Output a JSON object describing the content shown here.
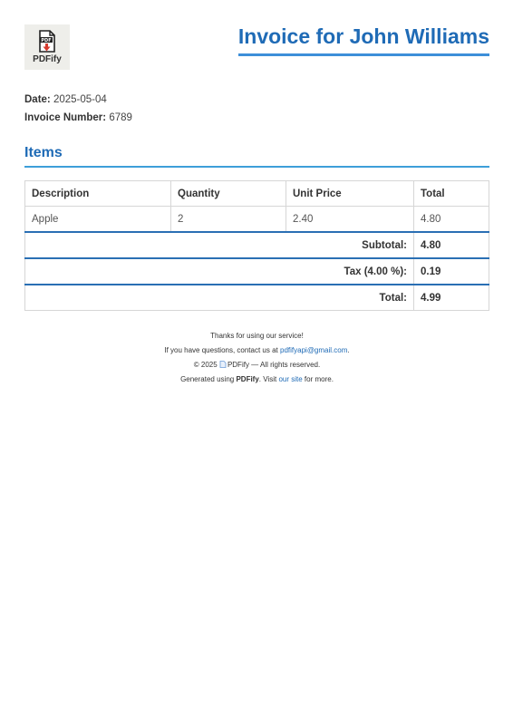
{
  "brand": {
    "logo_text": "PDFify",
    "icon": "pdf-download-icon"
  },
  "invoice": {
    "title": "Invoice for John Williams"
  },
  "meta": {
    "date_label": "Date:",
    "date_value": "2025-05-04",
    "number_label": "Invoice Number:",
    "number_value": "6789"
  },
  "items": {
    "title": "Items",
    "headers": [
      "Description",
      "Quantity",
      "Unit Price",
      "Total"
    ],
    "rows": [
      [
        "Apple",
        "2",
        "2.40",
        "4.80"
      ]
    ]
  },
  "totals": {
    "subtotal_label": "Subtotal:",
    "subtotal_value": "4.80",
    "tax_label": "Tax (4.00 %):",
    "tax_value": "0.19",
    "total_label": "Total:",
    "total_value": "4.99"
  },
  "footer": {
    "thanks": "Thanks for using our service!",
    "contact_prefix": "If you have questions, contact us at",
    "contact_email": "pdfifyapi@gmail.com",
    "contact_suffix": ".",
    "copyright_prefix": "© 2025",
    "copyright_brand": "PDFify",
    "copyright_suffix": "— All rights reserved.",
    "generated_prefix": "Generated using",
    "generated_brand": "PDFify",
    "generated_mid": ". Visit",
    "site_link": "our site",
    "generated_suffix": "for more."
  },
  "colors": {
    "accent": "#1f6bb6",
    "rule": "#3d8fd9"
  }
}
